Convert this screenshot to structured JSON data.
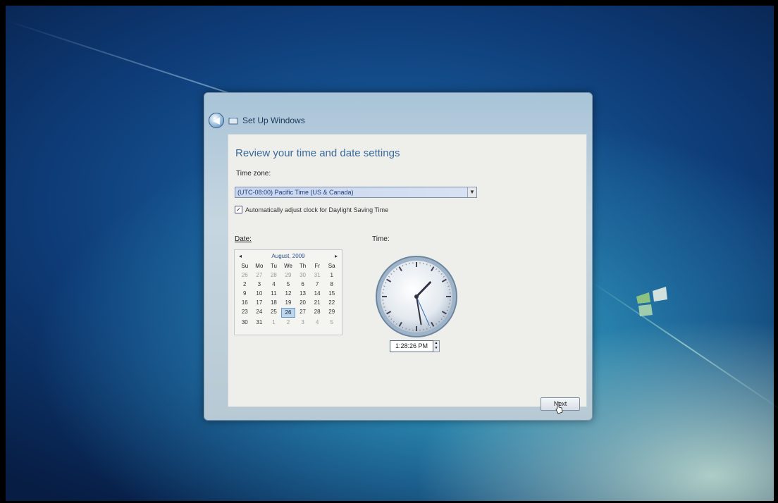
{
  "window": {
    "title": "Set Up Windows",
    "icon": "setup-icon"
  },
  "content": {
    "heading": "Review your time and date settings",
    "time_zone_label": "Time zone:",
    "time_zone_value": "(UTC-08:00) Pacific Time (US & Canada)",
    "dst_label": "Automatically adjust clock for Daylight Saving Time",
    "dst_checked": true,
    "date_label": "Date:",
    "time_label": "Time:"
  },
  "calendar": {
    "prev": "◂",
    "next": "▸",
    "month": "August, 2009",
    "days_of_week": [
      "Su",
      "Mo",
      "Tu",
      "We",
      "Th",
      "Fr",
      "Sa"
    ],
    "weeks": [
      [
        "26",
        "27",
        "28",
        "29",
        "30",
        "31",
        "1"
      ],
      [
        "2",
        "3",
        "4",
        "5",
        "6",
        "7",
        "8"
      ],
      [
        "9",
        "10",
        "11",
        "12",
        "13",
        "14",
        "15"
      ],
      [
        "16",
        "17",
        "18",
        "19",
        "20",
        "21",
        "22"
      ],
      [
        "23",
        "24",
        "25",
        "26",
        "27",
        "28",
        "29"
      ],
      [
        "30",
        "31",
        "1",
        "2",
        "3",
        "4",
        "5"
      ]
    ],
    "selected_day": "26"
  },
  "clock": {
    "time": "1:28:26 PM",
    "hours": 1,
    "minutes": 28,
    "seconds": 26
  },
  "buttons": {
    "next": "Next"
  },
  "colors": {
    "heading": "#3a6a9a",
    "selected_date": "#bcd6ef",
    "window_frame": "#a9c4d8"
  }
}
